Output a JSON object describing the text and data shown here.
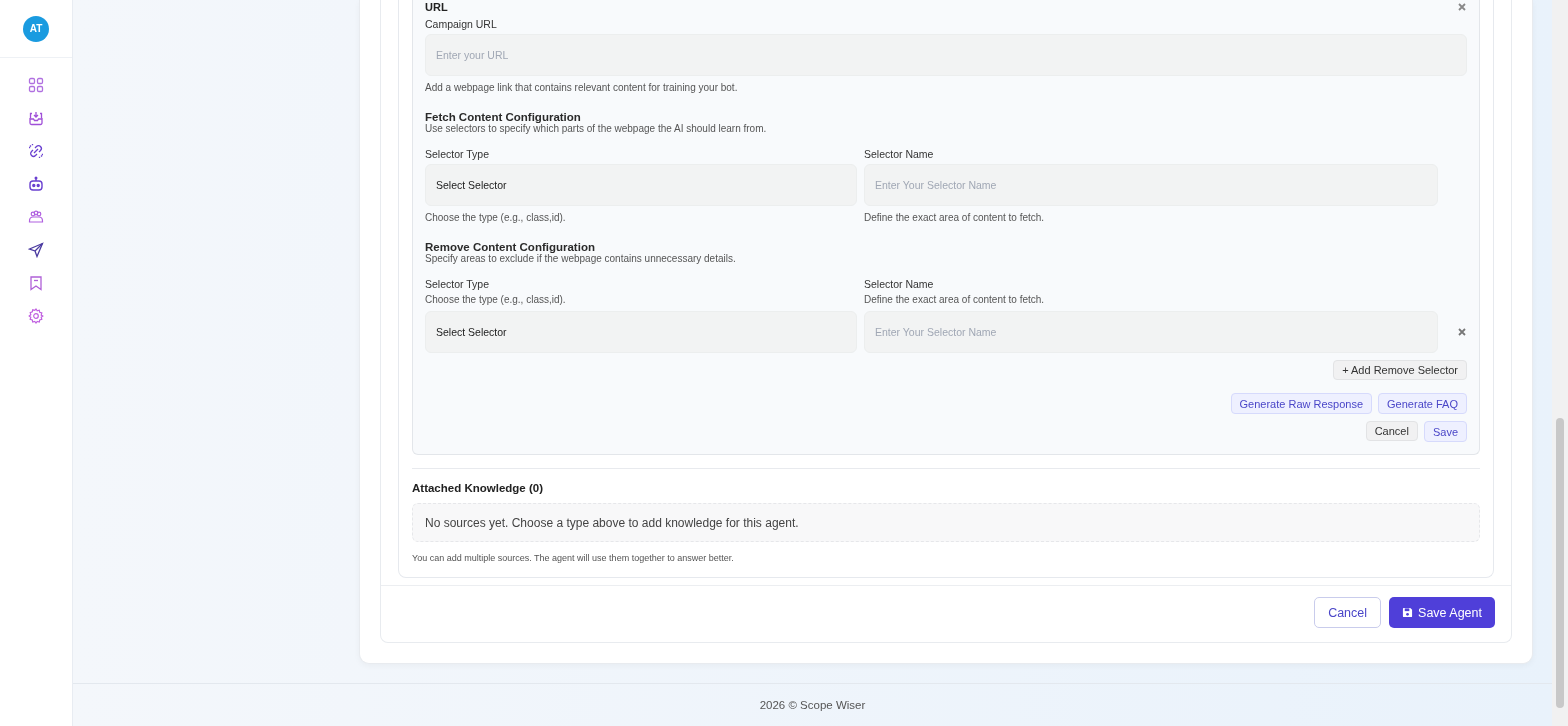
{
  "sidebar": {
    "avatar": "AT",
    "items": [
      {
        "kind": "grid"
      },
      {
        "kind": "inbox"
      },
      {
        "kind": "link"
      },
      {
        "kind": "bot"
      },
      {
        "kind": "team"
      },
      {
        "kind": "send"
      },
      {
        "kind": "bookmark"
      },
      {
        "kind": "settings"
      }
    ]
  },
  "url_source": {
    "title": "URL",
    "campaign_url": {
      "label": "Campaign URL",
      "placeholder": "Enter your URL",
      "help": "Add a webpage link that contains relevant content for training your bot."
    },
    "fetch_config": {
      "title": "Fetch Content Configuration",
      "description": "Use selectors to specify which parts of the webpage the AI should learn from.",
      "type_label": "Selector Type",
      "type_value": "Select Selector",
      "type_help": "Choose the type (e.g., class,id).",
      "name_label": "Selector Name",
      "name_placeholder": "Enter Your Selector Name",
      "name_help": "Define the exact area of content to fetch."
    },
    "remove_config": {
      "title": "Remove Content Configuration",
      "description": "Specify areas to exclude if the webpage contains unnecessary details.",
      "type_label": "Selector Type",
      "type_help": "Choose the type (e.g., class,id).",
      "name_label": "Selector Name",
      "name_help": "Define the exact area of content to fetch.",
      "rows": [
        {
          "type_value": "Select Selector",
          "name_placeholder": "Enter Your Selector Name"
        }
      ],
      "add_button": "+ Add Remove Selector"
    },
    "generate_buttons": [
      "Generate Raw Response",
      "Generate FAQ"
    ],
    "cancel": "Cancel",
    "save": "Save"
  },
  "attached_knowledge": {
    "title": "Attached Knowledge (0)",
    "empty": "No sources yet. Choose a type above to add knowledge for this agent.",
    "note": "You can add multiple sources. The agent will use them together to answer better."
  },
  "form_actions": {
    "cancel": "Cancel",
    "save": "Save Agent"
  },
  "footer": "2026 © Scope Wiser"
}
